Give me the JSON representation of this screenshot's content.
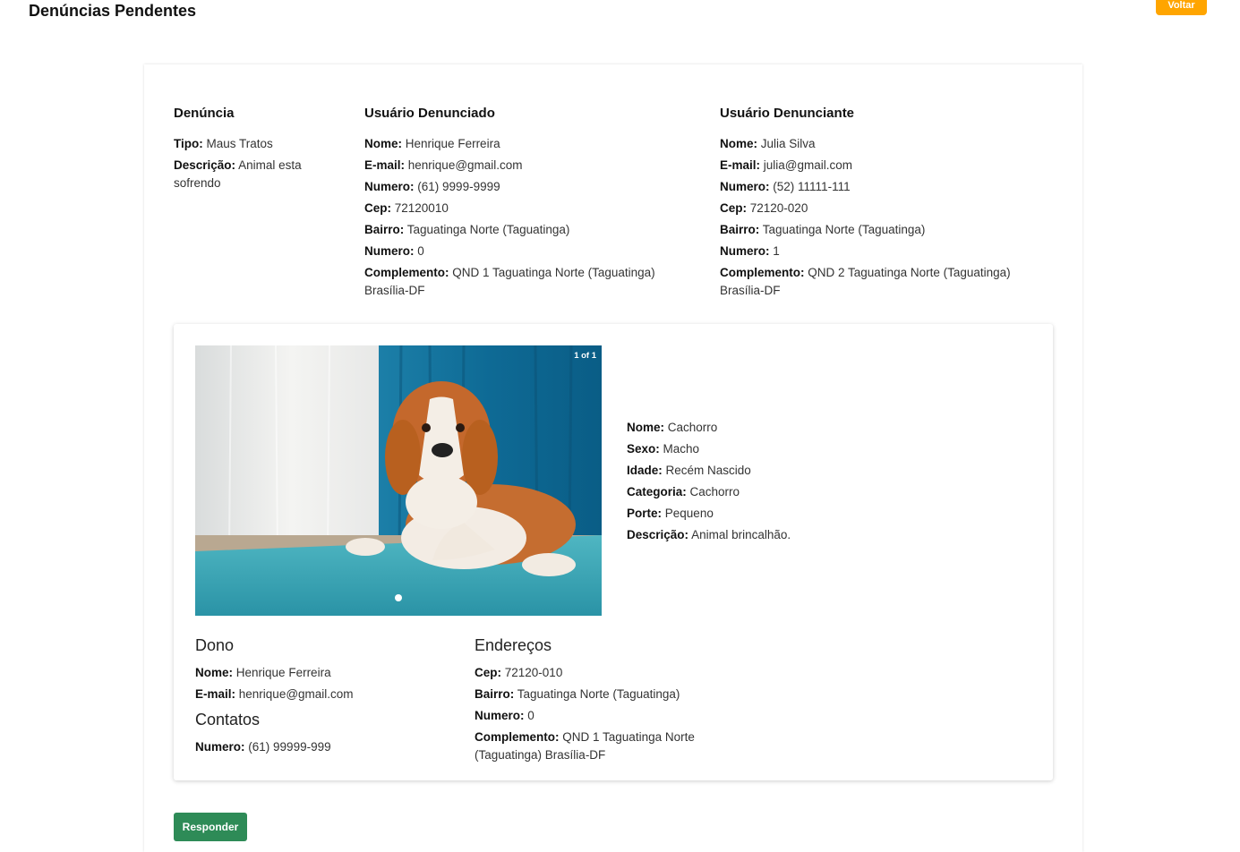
{
  "header": {
    "title": "Denúncias Pendentes",
    "back_label": "Voltar"
  },
  "denuncia": {
    "title": "Denúncia",
    "tipo_label": "Tipo:",
    "tipo": "Maus Tratos",
    "descricao_label": "Descrição:",
    "descricao": "Animal esta sofrendo"
  },
  "denunciado": {
    "title": "Usuário Denunciado",
    "fields": [
      {
        "label": "Nome:",
        "value": "Henrique Ferreira"
      },
      {
        "label": "E-mail:",
        "value": "henrique@gmail.com"
      },
      {
        "label": "Numero:",
        "value": "(61) 9999-9999"
      },
      {
        "label": "Cep:",
        "value": "72120010"
      },
      {
        "label": "Bairro:",
        "value": "Taguatinga Norte (Taguatinga)"
      },
      {
        "label": "Numero:",
        "value": "0"
      },
      {
        "label": "Complemento:",
        "value": "QND 1 Taguatinga Norte (Taguatinga) Brasília-DF"
      }
    ]
  },
  "denunciante": {
    "title": "Usuário Denunciante",
    "fields": [
      {
        "label": "Nome:",
        "value": "Julia Silva"
      },
      {
        "label": "E-mail:",
        "value": "julia@gmail.com"
      },
      {
        "label": "Numero:",
        "value": "(52) 11111-111"
      },
      {
        "label": "Cep:",
        "value": "72120-020"
      },
      {
        "label": "Bairro:",
        "value": "Taguatinga Norte (Taguatinga)"
      },
      {
        "label": "Numero:",
        "value": "1"
      },
      {
        "label": "Complemento:",
        "value": "QND 2 Taguatinga Norte (Taguatinga) Brasília-DF"
      }
    ]
  },
  "carousel": {
    "counter": "1 of 1",
    "image": "beagle-dog-photo"
  },
  "pet": {
    "fields": [
      {
        "label": "Nome:",
        "value": "Cachorro"
      },
      {
        "label": "Sexo:",
        "value": "Macho"
      },
      {
        "label": "Idade:",
        "value": "Recém Nascido"
      },
      {
        "label": "Categoria:",
        "value": "Cachorro"
      },
      {
        "label": "Porte:",
        "value": "Pequeno"
      },
      {
        "label": "Descrição:",
        "value": "Animal brincalhão."
      }
    ]
  },
  "dono": {
    "title": "Dono",
    "fields": [
      {
        "label": "Nome:",
        "value": "Henrique Ferreira"
      },
      {
        "label": "E-mail:",
        "value": "henrique@gmail.com"
      }
    ],
    "contatos_title": "Contatos",
    "contatos": [
      {
        "label": "Numero:",
        "value": "(61) 99999-999"
      }
    ]
  },
  "enderecos": {
    "title": "Endereços",
    "fields": [
      {
        "label": "Cep:",
        "value": "72120-010"
      },
      {
        "label": "Bairro:",
        "value": "Taguatinga Norte (Taguatinga)"
      },
      {
        "label": "Numero:",
        "value": "0"
      },
      {
        "label": "Complemento:",
        "value": "QND 1 Taguatinga Norte (Taguatinga) Brasília-DF"
      }
    ]
  },
  "actions": {
    "respond_label": "Responder"
  },
  "colors": {
    "back_button": "#ffa500",
    "respond_button": "#2e8b57"
  }
}
